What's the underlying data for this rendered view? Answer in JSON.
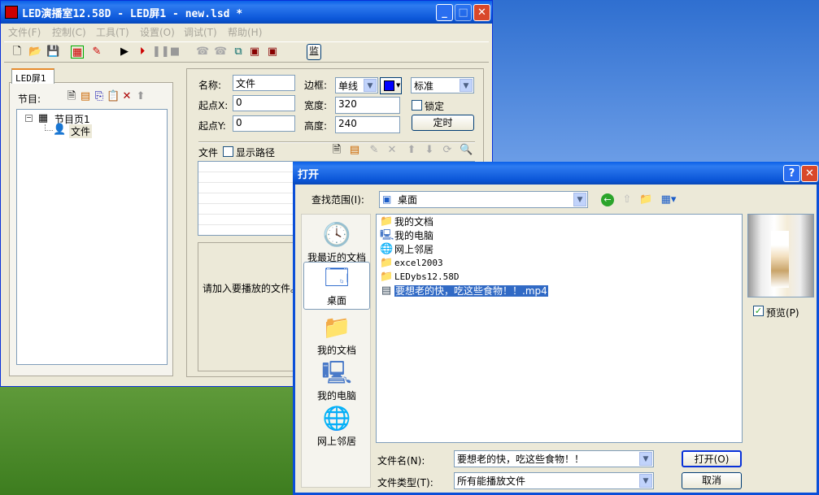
{
  "main": {
    "title": "LED演播室12.58D - LED屏1 - new.lsd *",
    "menu": [
      "文件(F)",
      "控制(C)",
      "工具(T)",
      "设置(O)",
      "调试(T)",
      "帮助(H)"
    ],
    "monitor_btn": "监",
    "tab": "LED屏1",
    "program_label": "节目:",
    "tree": {
      "page": "节目页1",
      "item": "文件"
    },
    "props": {
      "name_label": "名称:",
      "name": "文件",
      "border_label": "边框:",
      "border": "单线",
      "border_color": "#0000ff",
      "style": "标准",
      "x_label": "起点X:",
      "x": "0",
      "width_label": "宽度:",
      "width": "320",
      "lock": "锁定",
      "y_label": "起点Y:",
      "y": "0",
      "height_label": "高度:",
      "height": "240",
      "timer": "定时"
    },
    "files_label": "文件",
    "show_path": "显示路径",
    "hint": "请加入要播放的文件。"
  },
  "dialog": {
    "title": "打开",
    "help": "?",
    "lookin_label": "查找范围(I):",
    "lookin": "桌面",
    "places": [
      "我最近的文档",
      "桌面",
      "我的文档",
      "我的电脑",
      "网上邻居"
    ],
    "files": [
      {
        "name": "我的文档",
        "icon": "folder-docs"
      },
      {
        "name": "我的电脑",
        "icon": "computer"
      },
      {
        "name": "网上邻居",
        "icon": "network"
      },
      {
        "name": "excel2003",
        "icon": "folder"
      },
      {
        "name": "LEDybs12.58D",
        "icon": "folder"
      },
      {
        "name": "要想老的快，吃这些食物！！.mp4",
        "icon": "video",
        "selected": true
      }
    ],
    "preview": "预览(P)",
    "filename_label": "文件名(N):",
    "filename": "要想老的快，吃这些食物！！",
    "filetype_label": "文件类型(T):",
    "filetype": "所有能播放文件",
    "open": "打开(O)",
    "cancel": "取消"
  }
}
